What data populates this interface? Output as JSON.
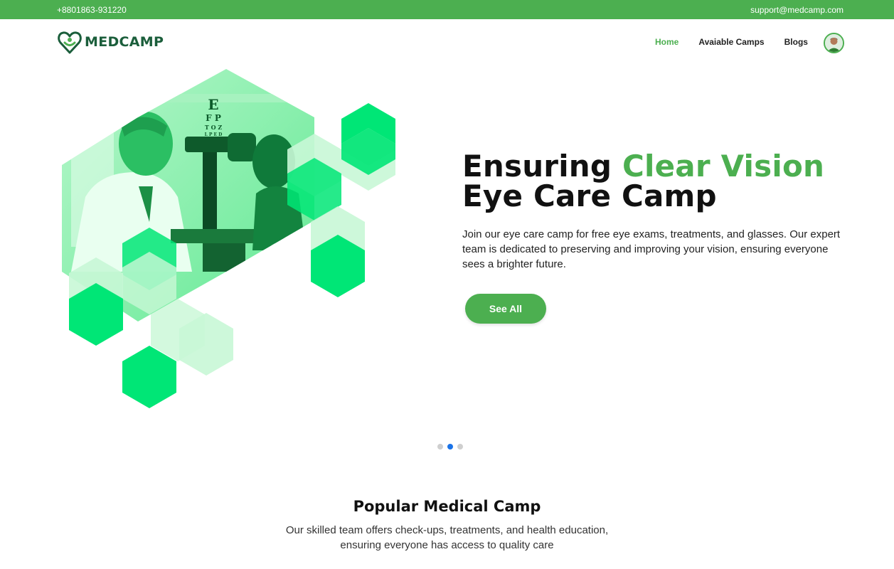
{
  "topbar": {
    "phone": "+8801863-931220",
    "email": "support@medcamp.com"
  },
  "brand": {
    "name": "MEDCAMP",
    "logo_icon": "heart-person-icon"
  },
  "nav": {
    "links": [
      {
        "label": "Home",
        "active": true
      },
      {
        "label": "Avaiable Camps",
        "active": false
      },
      {
        "label": "Blogs",
        "active": false
      }
    ],
    "avatar_icon": "user-avatar-icon"
  },
  "hero": {
    "title_prefix": "Ensuring ",
    "title_accent": "Clear Vision",
    "title_line2": "Eye Care Camp",
    "description": "Join our eye care camp for free eye exams, treatments, and glasses. Our expert team is dedicated to preserving and improving your vision, ensuring everyone sees a brighter future.",
    "cta_label": "See All",
    "image_icon": "eye-exam-photo",
    "eye_chart_lines": [
      "E",
      "F P",
      "T O Z",
      "L P E D"
    ]
  },
  "carousel": {
    "dot_count": 3,
    "active_index": 1
  },
  "popular": {
    "title": "Popular Medical Camp",
    "subtitle_line1": "Our skilled team offers check-ups, treatments, and health education,",
    "subtitle_line2": "ensuring everyone has access to quality care"
  },
  "colors": {
    "brand_green": "#4caf50",
    "logo_dark_green": "#1b5e3b",
    "hex_bright": "#00e676",
    "hex_pale": "#c8f7d6",
    "dot_active": "#1a73e8"
  }
}
